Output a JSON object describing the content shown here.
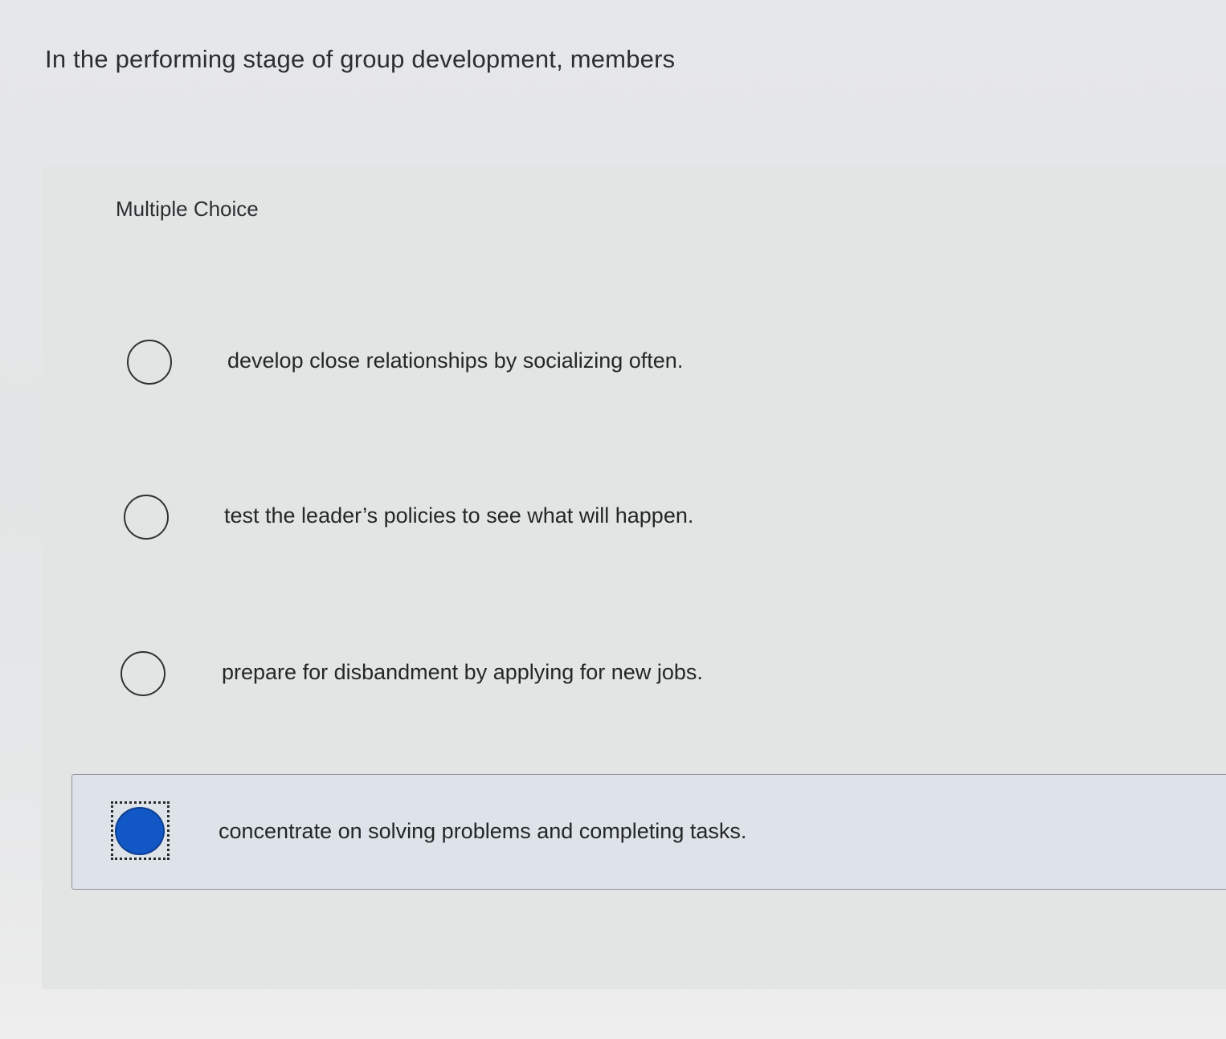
{
  "question": {
    "text": "In the performing stage of group development, members"
  },
  "quiz": {
    "type_label": "Multiple Choice",
    "selected_index": 3,
    "options": [
      {
        "label": "develop close relationships by socializing often.",
        "selected": false
      },
      {
        "label": "test the leader’s policies to see what will happen.",
        "selected": false
      },
      {
        "label": "prepare for disbandment by applying for new jobs.",
        "selected": false
      },
      {
        "label": "concentrate on solving problems and completing tasks.",
        "selected": true
      }
    ]
  },
  "colors": {
    "selected_radio": "#1257c6",
    "selected_row_background": "#dde3e8",
    "page_background": "#e5e6e8"
  }
}
